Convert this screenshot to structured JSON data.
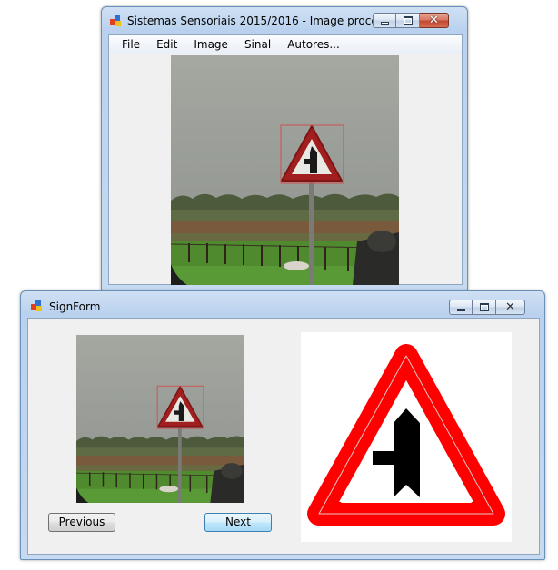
{
  "main_window": {
    "title": "Sistemas Sensoriais 2015/2016 - Image processin...",
    "menu": [
      {
        "label": "File"
      },
      {
        "label": "Edit"
      },
      {
        "label": "Image"
      },
      {
        "label": "Sinal"
      },
      {
        "label": "Autores..."
      }
    ],
    "image": {
      "subject": "road photo with triangular warning sign, red detection box around sign"
    },
    "colors": {
      "detection_box": "#d05050"
    }
  },
  "sign_window": {
    "title": "SignForm",
    "thumbnail": {
      "subject": "same road photo, scaled"
    },
    "reference_sign": {
      "subject": "triangular priority road sign: red border, white field, black side-road symbol"
    },
    "buttons": {
      "previous": "Previous",
      "next": "Next"
    },
    "colors": {
      "sign_border": "#ff0000",
      "sign_symbol": "#000000"
    }
  },
  "icons": {
    "app_icon": "app-window-icon",
    "minimize": "minimize-icon",
    "maximize": "maximize-icon",
    "close": "close-icon"
  }
}
